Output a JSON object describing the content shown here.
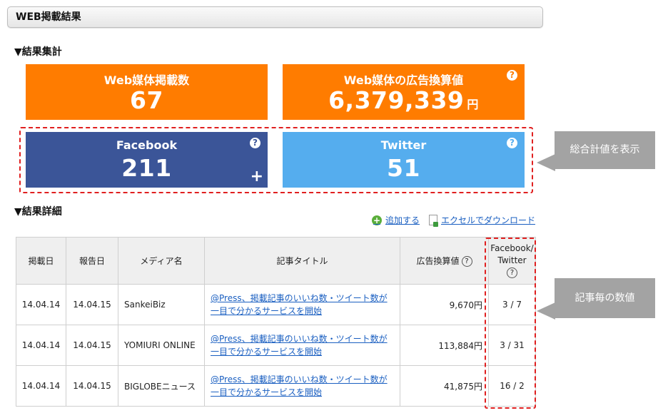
{
  "header": {
    "title": "WEB掲載結果"
  },
  "summary": {
    "heading": "▼結果集計",
    "web_count": {
      "label": "Web媒体掲載数",
      "value": "67"
    },
    "ad_value": {
      "label": "Web媒体の広告換算値",
      "value": "6,379,339",
      "unit": "円"
    },
    "facebook": {
      "label": "Facebook",
      "value": "211"
    },
    "twitter": {
      "label": "Twitter",
      "value": "51"
    }
  },
  "callouts": {
    "total": "総合計値を表示",
    "per_article": "記事毎の数値"
  },
  "details": {
    "heading": "▼結果詳細",
    "add_label": "追加する",
    "excel_label": "エクセルでダウンロード",
    "columns": [
      "掲載日",
      "報告日",
      "メディア名",
      "記事タイトル",
      "広告換算値",
      "Facebook/",
      "Twitter"
    ],
    "rows": [
      {
        "posted": "14.04.14",
        "reported": "14.04.15",
        "media": "SankeiBiz",
        "title1": "@Press、掲載記事のいいね数・ツイート数が",
        "title2": "一目で分かるサービスを開始",
        "value": "9,670円",
        "social": "3 / 7"
      },
      {
        "posted": "14.04.14",
        "reported": "14.04.15",
        "media": "YOMIURI ONLINE",
        "title1": "@Press、掲載記事のいいね数・ツイート数が",
        "title2": "一目で分かるサービスを開始",
        "value": "113,884円",
        "social": "3 / 31"
      },
      {
        "posted": "14.04.14",
        "reported": "14.04.15",
        "media": "BIGLOBEニュース",
        "title1": "@Press、掲載記事のいいね数・ツイート数が",
        "title2": "一目で分かるサービスを開始",
        "value": "41,875円",
        "social": "16 / 2"
      }
    ]
  },
  "colors": {
    "orange": "#ff7c00",
    "facebook_blue": "#3b5598",
    "twitter_blue": "#55adee",
    "highlight_red": "#e02020",
    "callout_gray": "#a3a3a3"
  },
  "icons": [
    "help-icon",
    "plus-icon",
    "add-icon",
    "excel-icon"
  ]
}
